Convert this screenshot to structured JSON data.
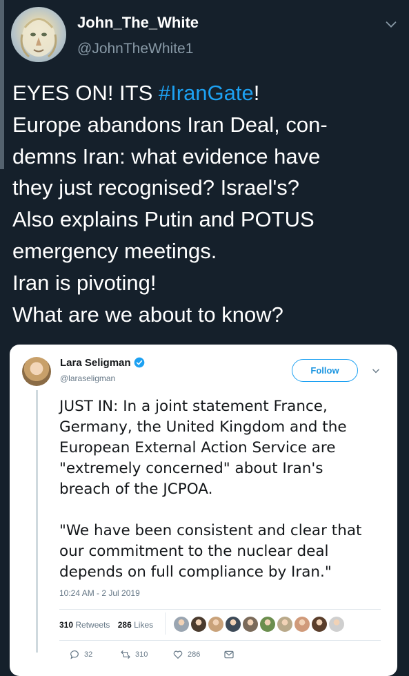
{
  "tweet": {
    "display_name": "John_The_White",
    "handle": "@JohnTheWhite1",
    "text_lines": [
      {
        "before": "EYES ON! ITS ",
        "hashtag": "#IranGate",
        "after": "!"
      },
      {
        "before": "Europe abandons Iran Deal, con-"
      },
      {
        "before": "demns Iran: what evidence have"
      },
      {
        "before": "they just recognised? Israel's?"
      },
      {
        "before": "Also explains Putin and POTUS"
      },
      {
        "before": "emergency meetings."
      },
      {
        "before": "Iran is pivoting!"
      },
      {
        "before": "What are we about to know?"
      }
    ],
    "menu_icon": "chevron-down",
    "accent_color": "#1da1f2"
  },
  "embedded": {
    "display_name": "Lara Seligman",
    "verified_icon": "verified-badge",
    "handle": "@laraseligman",
    "follow_label": "Follow",
    "menu_icon": "chevron-down",
    "paragraph1": [
      "JUST IN: In a joint statement France,",
      "Germany, the United Kingdom and the",
      "European External Action Service are",
      "\"extremely concerned\" about Iran's",
      "breach of the JCPOA."
    ],
    "paragraph2": [
      "\"We have been consistent and clear that",
      "our commitment to the nuclear deal",
      "depends on full compliance by Iran.\""
    ],
    "timestamp": "10:24 AM - 2 Jul 2019",
    "retweets_count": "310",
    "retweets_label": "Retweets",
    "likes_count": "286",
    "likes_label": "Likes",
    "liker_avatar_colors": [
      "#9aa5b1",
      "#4a3b2e",
      "#c9a27a",
      "#3d4a58",
      "#7a6a5a",
      "#6b8e4e",
      "#b9a98a",
      "#d09a7a",
      "#5a3e2b",
      "#cfcfcf"
    ],
    "actions": {
      "reply_count": "32",
      "retweet_count": "310",
      "like_count": "286"
    }
  }
}
